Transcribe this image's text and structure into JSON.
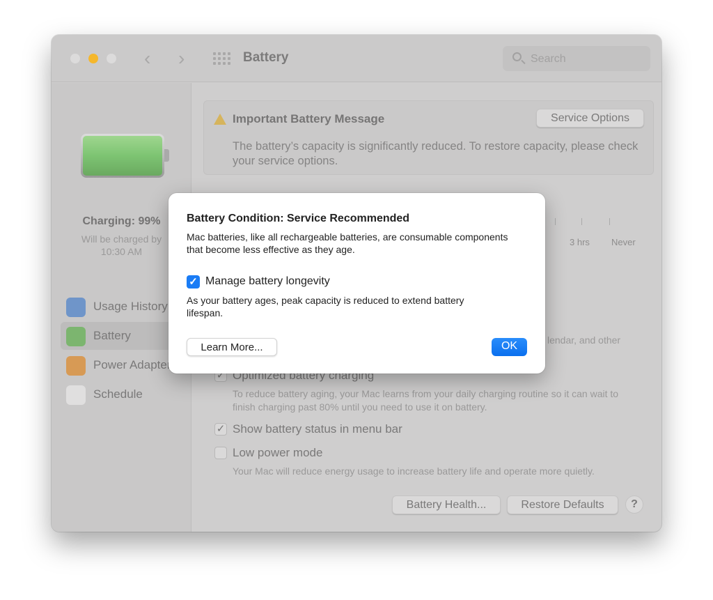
{
  "window": {
    "title": "Battery",
    "search_placeholder": "Search"
  },
  "sidebar": {
    "charging_status": "Charging: 99%",
    "charge_line1": "Will be charged by",
    "charge_line2": "10:30 AM",
    "battery_level_percent": 99,
    "items": [
      {
        "label": "Usage History",
        "icon": "usage-history-icon",
        "color": "#6f95c9"
      },
      {
        "label": "Battery",
        "icon": "battery-icon",
        "color": "#7cb56f",
        "selected": true
      },
      {
        "label": "Power Adapter",
        "icon": "power-adapter-icon",
        "color": "#d79a55"
      },
      {
        "label": "Schedule",
        "icon": "schedule-icon",
        "color": "#d9d8d8"
      }
    ]
  },
  "message": {
    "title": "Important Battery Message",
    "body": "The battery’s capacity is significantly reduced. To restore capacity, please check your service options.",
    "service_button": "Service Options"
  },
  "slider": {
    "labels": [
      "3 hrs",
      "Never"
    ]
  },
  "partial_text": "lendar, and other",
  "options": [
    {
      "label": "Optimized battery charging",
      "checked": true,
      "desc": "To reduce battery aging, your Mac learns from your daily charging routine so it can wait to finish charging past 80% until you need to use it on battery."
    },
    {
      "label": "Show battery status in menu bar",
      "checked": true
    },
    {
      "label": "Low power mode",
      "checked": false,
      "desc": "Your Mac will reduce energy usage to increase battery life and operate more quietly."
    }
  ],
  "footer": {
    "battery_health": "Battery Health...",
    "restore_defaults": "Restore Defaults",
    "help": "?"
  },
  "dialog": {
    "title": "Battery Condition: Service Recommended",
    "body": "Mac batteries, like all rechargeable batteries, are consumable components that become less effective as they age.",
    "checkbox_label": "Manage battery longevity",
    "checkbox_checked": true,
    "checkbox_desc": "As your battery ages, peak capacity is reduced to extend battery lifespan.",
    "learn_more": "Learn More...",
    "ok": "OK"
  },
  "colors": {
    "accent": "#0a6fee",
    "traffic_minimize": "#f5b72c",
    "warning": "#d6b45c"
  }
}
